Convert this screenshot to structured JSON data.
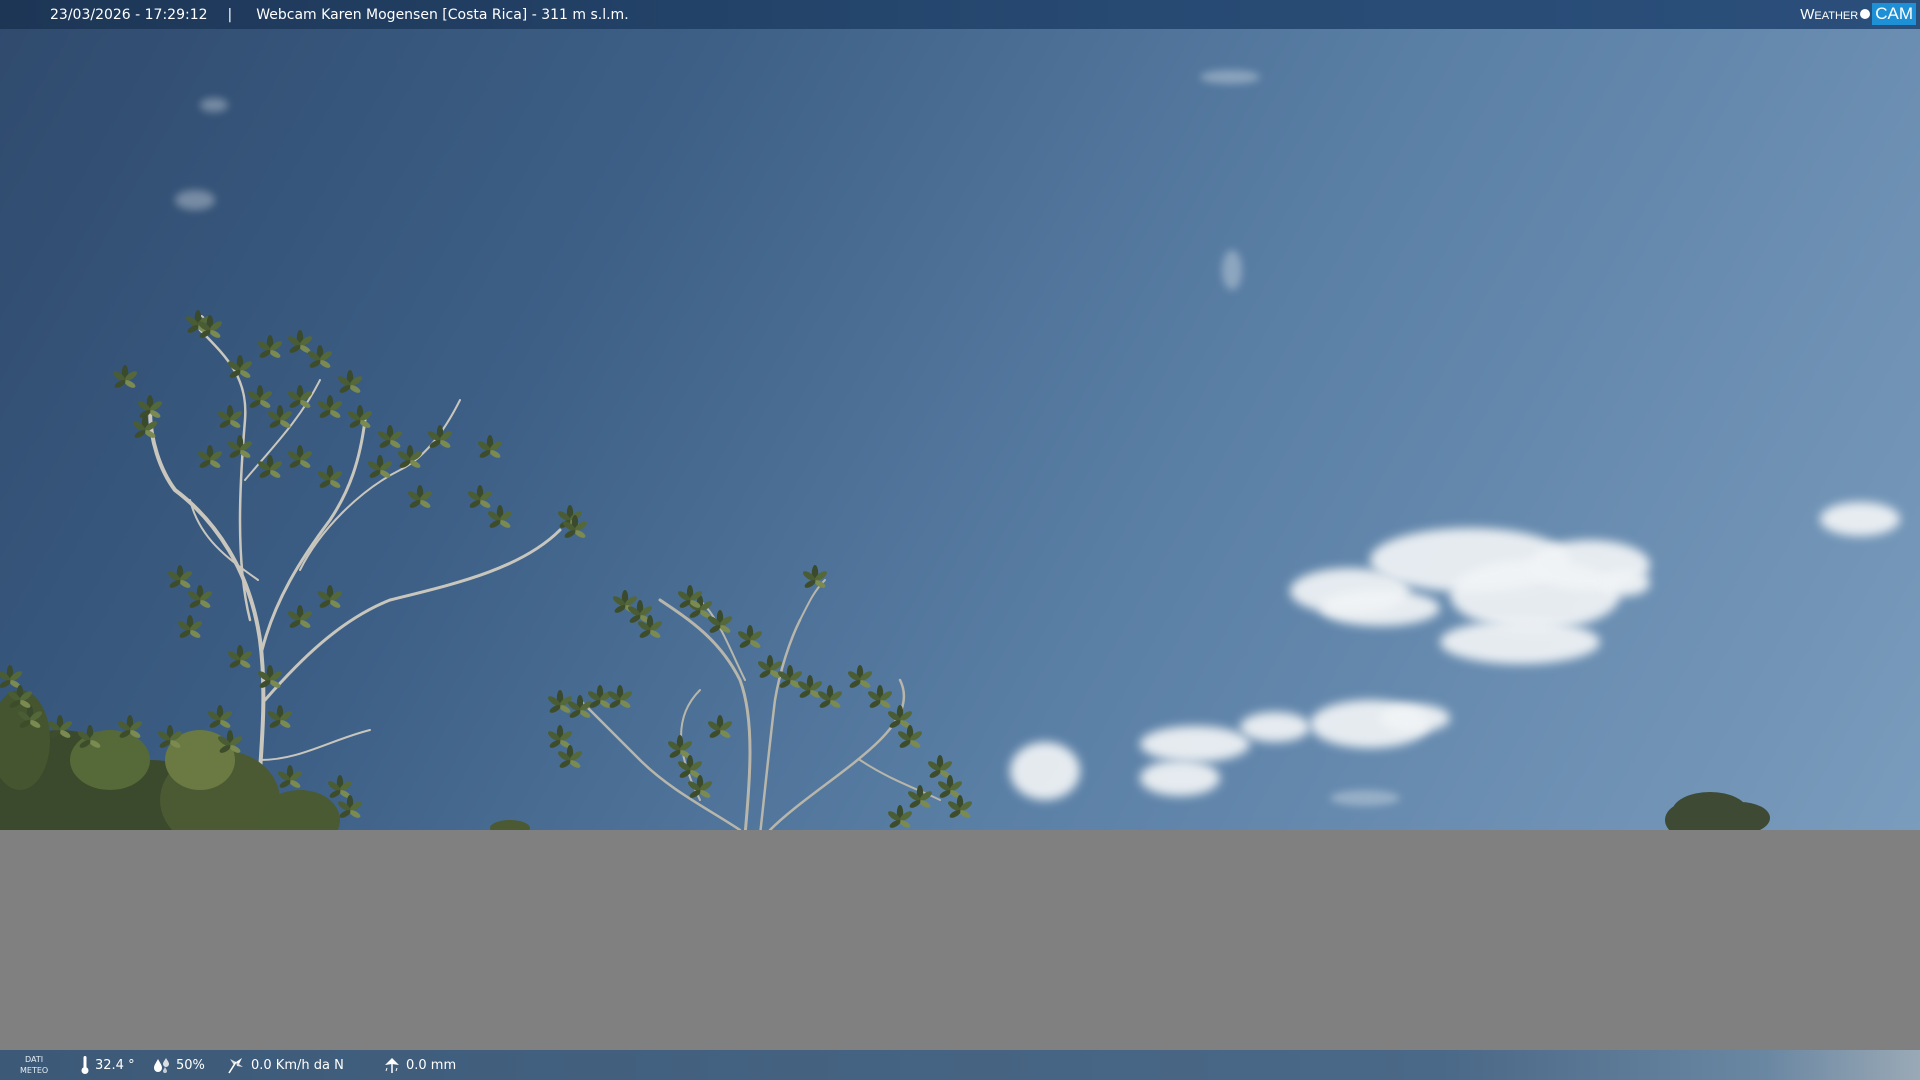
{
  "overlay": {
    "datetime": "23/03/2026 - 17:29:12",
    "separator": "|",
    "webcam_title": "Webcam Karen Mogensen [Costa Rica]  - 311 m s.l.m."
  },
  "logo": {
    "weather_text": "Weather",
    "cam_text": "CAM"
  },
  "weather_bar": {
    "label_line1": "DATI",
    "label_line2": "METEO",
    "temperature": "32.4 °",
    "humidity": "50%",
    "wind": "0.0 Km/h da N",
    "rain": "0.0 mm",
    "icons": [
      "thermometer-icon",
      "humidity-icon",
      "wind-icon",
      "rain-gauge-icon"
    ]
  },
  "colors": {
    "sky_dark": "#2f4a6d",
    "sky_light": "#7a9cbd",
    "gray_area": "#808080",
    "logo_accent": "#1e90d6"
  }
}
